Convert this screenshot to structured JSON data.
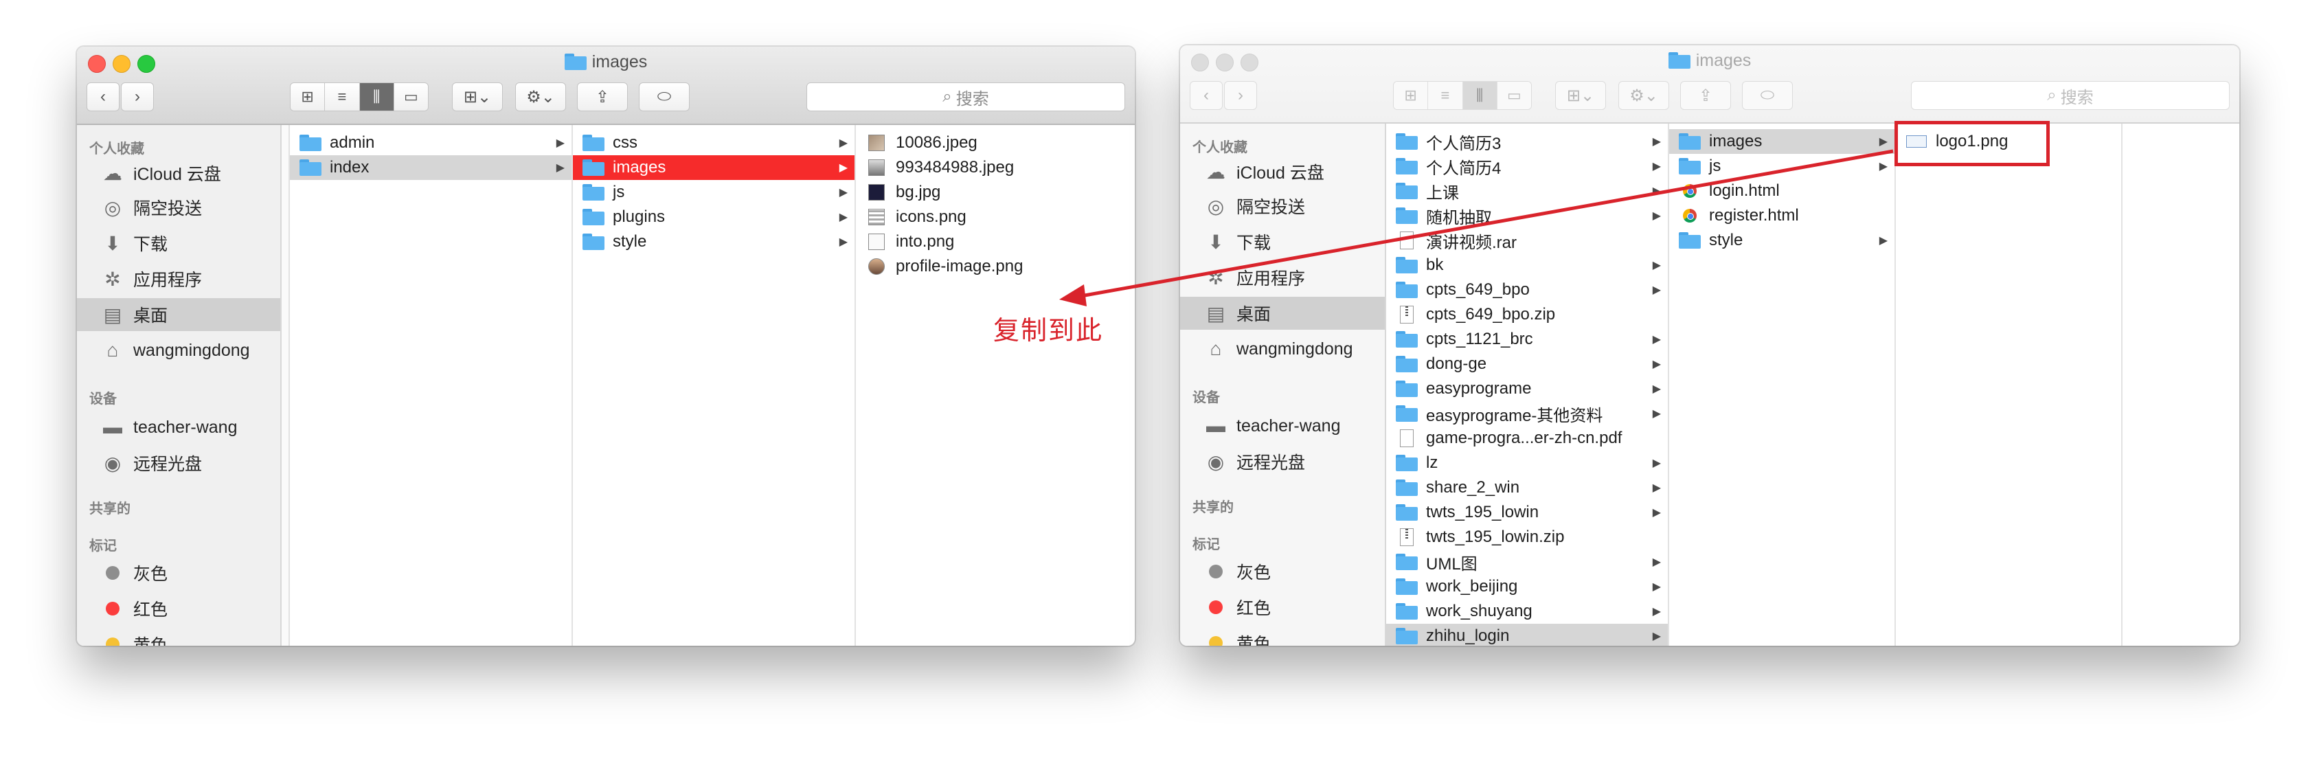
{
  "annotation": {
    "label": "复制到此",
    "color": "#d9232b"
  },
  "window1": {
    "title": "images",
    "search_placeholder": "搜索",
    "sidebar": {
      "favorites_header": "个人收藏",
      "favorites": [
        {
          "label": "iCloud 云盘",
          "icon": "cloud-icon"
        },
        {
          "label": "隔空投送",
          "icon": "airdrop-icon"
        },
        {
          "label": "下载",
          "icon": "download-icon"
        },
        {
          "label": "应用程序",
          "icon": "applications-icon"
        },
        {
          "label": "桌面",
          "icon": "desktop-icon",
          "selected": true
        },
        {
          "label": "wangmingdong",
          "icon": "home-icon"
        }
      ],
      "devices_header": "设备",
      "devices": [
        {
          "label": "teacher-wang",
          "icon": "laptop-icon"
        },
        {
          "label": "远程光盘",
          "icon": "disc-icon"
        }
      ],
      "shared_header": "共享的",
      "tags_header": "标记",
      "tags": [
        {
          "label": "灰色",
          "color": "#8e8e8e"
        },
        {
          "label": "红色",
          "color": "#fb3d3d"
        },
        {
          "label": "黄色",
          "color": "#f5c134"
        }
      ]
    },
    "col1": [
      {
        "label": "admin",
        "type": "folder",
        "arrow": true
      },
      {
        "label": "index",
        "type": "folder",
        "arrow": true,
        "state": "gray"
      }
    ],
    "col2": [
      {
        "label": "css",
        "type": "folder",
        "arrow": true
      },
      {
        "label": "images",
        "type": "folder",
        "arrow": true,
        "state": "red"
      },
      {
        "label": "js",
        "type": "folder",
        "arrow": true
      },
      {
        "label": "plugins",
        "type": "folder",
        "arrow": true
      },
      {
        "label": "style",
        "type": "folder",
        "arrow": true
      }
    ],
    "col3": [
      {
        "label": "10086.jpeg",
        "type": "img"
      },
      {
        "label": "993484988.jpeg",
        "type": "img-person"
      },
      {
        "label": "bg.jpg",
        "type": "img-dark"
      },
      {
        "label": "icons.png",
        "type": "img-grid"
      },
      {
        "label": "into.png",
        "type": "img-blank"
      },
      {
        "label": "profile-image.png",
        "type": "img-round"
      }
    ]
  },
  "window2": {
    "title": "images",
    "search_placeholder": "搜索",
    "sidebar": {
      "favorites_header": "个人收藏",
      "favorites": [
        {
          "label": "iCloud 云盘",
          "icon": "cloud-icon"
        },
        {
          "label": "隔空投送",
          "icon": "airdrop-icon"
        },
        {
          "label": "下载",
          "icon": "download-icon"
        },
        {
          "label": "应用程序",
          "icon": "applications-icon"
        },
        {
          "label": "桌面",
          "icon": "desktop-icon",
          "selected": true
        },
        {
          "label": "wangmingdong",
          "icon": "home-icon"
        }
      ],
      "devices_header": "设备",
      "devices": [
        {
          "label": "teacher-wang",
          "icon": "laptop-icon"
        },
        {
          "label": "远程光盘",
          "icon": "disc-icon"
        }
      ],
      "shared_header": "共享的",
      "tags_header": "标记",
      "tags": [
        {
          "label": "灰色",
          "color": "#8e8e8e"
        },
        {
          "label": "红色",
          "color": "#fb3d3d"
        },
        {
          "label": "黄色",
          "color": "#f5c134"
        }
      ]
    },
    "col1": [
      {
        "label": "个人简历3",
        "type": "folder",
        "arrow": true
      },
      {
        "label": "个人简历4",
        "type": "folder",
        "arrow": true
      },
      {
        "label": "上课",
        "type": "folder",
        "arrow": true
      },
      {
        "label": "随机抽取",
        "type": "folder",
        "arrow": true
      },
      {
        "label": "演讲视频.rar",
        "type": "file"
      },
      {
        "label": "bk",
        "type": "folder",
        "arrow": true
      },
      {
        "label": "cpts_649_bpo",
        "type": "folder",
        "arrow": true
      },
      {
        "label": "cpts_649_bpo.zip",
        "type": "zip"
      },
      {
        "label": "cpts_1121_brc",
        "type": "folder",
        "arrow": true
      },
      {
        "label": "dong-ge",
        "type": "folder",
        "arrow": true
      },
      {
        "label": "easyprograme",
        "type": "folder",
        "arrow": true
      },
      {
        "label": "easyprograme-其他资料",
        "type": "folder",
        "arrow": true
      },
      {
        "label": "game-progra...er-zh-cn.pdf",
        "type": "file"
      },
      {
        "label": "lz",
        "type": "folder",
        "arrow": true
      },
      {
        "label": "share_2_win",
        "type": "folder",
        "arrow": true
      },
      {
        "label": "twts_195_lowin",
        "type": "folder",
        "arrow": true
      },
      {
        "label": "twts_195_lowin.zip",
        "type": "zip"
      },
      {
        "label": "UML图",
        "type": "folder",
        "arrow": true
      },
      {
        "label": "work_beijing",
        "type": "folder",
        "arrow": true
      },
      {
        "label": "work_shuyang",
        "type": "folder",
        "arrow": true
      },
      {
        "label": "zhihu_login",
        "type": "folder",
        "arrow": true,
        "state": "gray"
      }
    ],
    "col2": [
      {
        "label": "images",
        "type": "folder",
        "arrow": true,
        "state": "gray"
      },
      {
        "label": "js",
        "type": "folder",
        "arrow": true
      },
      {
        "label": "login.html",
        "type": "chrome"
      },
      {
        "label": "register.html",
        "type": "chrome"
      },
      {
        "label": "style",
        "type": "folder",
        "arrow": true
      }
    ],
    "col3": [
      {
        "label": "logo1.png",
        "type": "png-small"
      }
    ]
  }
}
